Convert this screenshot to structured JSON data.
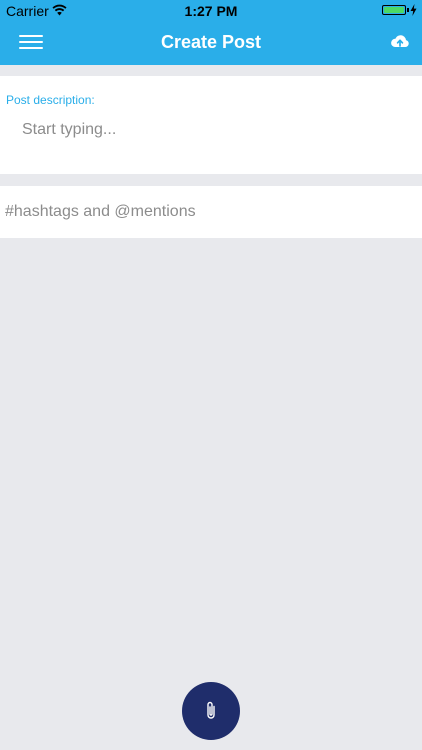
{
  "status_bar": {
    "carrier": "Carrier",
    "time": "1:27 PM",
    "icons": [
      "wifi-icon",
      "battery-icon",
      "charging-icon"
    ]
  },
  "nav_bar": {
    "title": "Create Post",
    "left_icon": "menu-icon",
    "right_icon": "cloud-upload-icon"
  },
  "post_form": {
    "description_label": "Post description:",
    "description_placeholder": "Start typing...",
    "tags_placeholder": "#hashtags and @mentions"
  },
  "fab": {
    "icon": "paperclip-icon"
  },
  "colors": {
    "accent": "#2aaee9",
    "background": "#e8e9ed",
    "fab": "#1f2d6b"
  }
}
